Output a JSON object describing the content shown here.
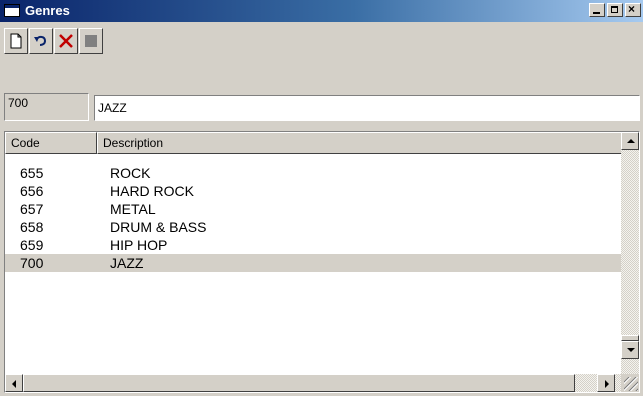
{
  "window": {
    "title": "Genres"
  },
  "toolbar": {
    "icons": [
      "new-document-icon",
      "undo-icon",
      "delete-icon",
      "save-icon"
    ]
  },
  "editor": {
    "code_value": "700",
    "description_value": "JAZZ"
  },
  "list": {
    "columns": [
      "Code",
      "Description"
    ],
    "rows": [
      {
        "code": "655",
        "description": "ROCK"
      },
      {
        "code": "656",
        "description": "HARD ROCK"
      },
      {
        "code": "657",
        "description": "METAL"
      },
      {
        "code": "658",
        "description": "DRUM & BASS"
      },
      {
        "code": "659",
        "description": "HIP HOP"
      },
      {
        "code": "700",
        "description": "JAZZ"
      }
    ],
    "selected_code": "700"
  },
  "colors": {
    "titlebar_start": "#0a246a",
    "titlebar_end": "#a6caf0",
    "delete_icon": "#c00000"
  }
}
